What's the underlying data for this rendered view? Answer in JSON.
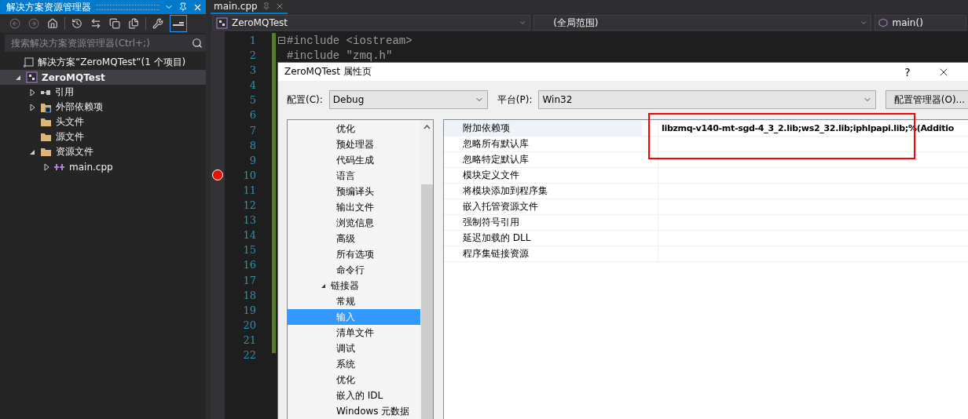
{
  "explorer": {
    "title": "解决方案资源管理器",
    "search": {
      "placeholder": "搜索解决方案资源管理器(Ctrl+;)"
    },
    "tree": [
      {
        "label": "解决方案“ZeroMQTest”(1 个项目)",
        "kind": "solution",
        "selected": false,
        "children": [
          {
            "label": "ZeroMQTest",
            "kind": "project",
            "selected": true,
            "expanded": true,
            "children": [
              {
                "label": "引用",
                "kind": "references",
                "selected": false,
                "expanded": false
              },
              {
                "label": "外部依赖项",
                "kind": "external",
                "selected": false,
                "expanded": false
              },
              {
                "label": "头文件",
                "kind": "folder",
                "selected": false
              },
              {
                "label": "源文件",
                "kind": "folder",
                "selected": false
              },
              {
                "label": "资源文件",
                "kind": "folder",
                "selected": false,
                "expanded": true,
                "children": [
                  {
                    "label": "main.cpp",
                    "kind": "cpp",
                    "selected": false,
                    "expanded": false
                  }
                ]
              }
            ]
          }
        ]
      }
    ]
  },
  "editor": {
    "tab": "main.cpp",
    "nav": {
      "project": "ZeroMQTest",
      "scope": "(全局范围)",
      "member": "main()"
    },
    "lines": [
      {
        "number": "1",
        "code": "#include <iostream>",
        "breakpoint": false,
        "fold": true
      },
      {
        "number": "2",
        "code": "#include \"zmq.h\"",
        "breakpoint": false,
        "fold": false
      },
      {
        "number": "3",
        "breakpoint": false,
        "fold": false
      },
      {
        "number": "4",
        "breakpoint": false,
        "fold": false
      },
      {
        "number": "5",
        "breakpoint": false,
        "fold": false
      },
      {
        "number": "6",
        "breakpoint": false,
        "fold": false
      },
      {
        "number": "7",
        "breakpoint": false,
        "fold": false
      },
      {
        "number": "8",
        "breakpoint": false,
        "fold": false
      },
      {
        "number": "9",
        "breakpoint": false,
        "fold": false
      },
      {
        "number": "10",
        "breakpoint": true,
        "fold": false
      },
      {
        "number": "11",
        "breakpoint": false,
        "fold": false
      },
      {
        "number": "12",
        "breakpoint": false,
        "fold": false
      },
      {
        "number": "13",
        "breakpoint": false,
        "fold": false
      },
      {
        "number": "14",
        "breakpoint": false,
        "fold": false
      },
      {
        "number": "15",
        "breakpoint": false,
        "fold": false
      },
      {
        "number": "16",
        "breakpoint": false,
        "fold": false
      },
      {
        "number": "17",
        "breakpoint": false,
        "fold": false
      },
      {
        "number": "18",
        "breakpoint": false,
        "fold": false
      },
      {
        "number": "19",
        "breakpoint": false,
        "fold": false
      },
      {
        "number": "20",
        "breakpoint": false,
        "fold": false
      },
      {
        "number": "21",
        "breakpoint": false,
        "fold": false
      },
      {
        "number": "22",
        "breakpoint": false,
        "fold": false
      }
    ]
  },
  "dialog": {
    "title": "ZeroMQTest 属性页",
    "help": "?",
    "configuration": {
      "label": "配置(C):",
      "value": "Debug"
    },
    "platform": {
      "label": "平台(P):",
      "value": "Win32"
    },
    "manager_button": "配置管理器(O)...",
    "tree": [
      {
        "label": "优化",
        "selected": false
      },
      {
        "label": "预处理器",
        "selected": false
      },
      {
        "label": "代码生成",
        "selected": false
      },
      {
        "label": "语言",
        "selected": false
      },
      {
        "label": "预编译头",
        "selected": false
      },
      {
        "label": "输出文件",
        "selected": false
      },
      {
        "label": "浏览信息",
        "selected": false
      },
      {
        "label": "高级",
        "selected": false
      },
      {
        "label": "所有选项",
        "selected": false
      },
      {
        "label": "命令行",
        "selected": false
      },
      {
        "label": "链接器",
        "selected": false,
        "expanded": true,
        "children": [
          {
            "label": "常规",
            "selected": false
          },
          {
            "label": "输入",
            "selected": true
          },
          {
            "label": "清单文件",
            "selected": false
          },
          {
            "label": "调试",
            "selected": false
          },
          {
            "label": "系统",
            "selected": false
          },
          {
            "label": "优化",
            "selected": false
          },
          {
            "label": "嵌入的 IDL",
            "selected": false
          },
          {
            "label": "Windows 元数据",
            "selected": false
          }
        ]
      }
    ],
    "properties": [
      {
        "name": "附加依赖项",
        "value": "libzmq-v140-mt-sgd-4_3_2.lib;ws2_32.lib;iphlpapi.lib;%(Additio",
        "selected": true
      },
      {
        "name": "忽略所有默认库",
        "selected": false
      },
      {
        "name": "忽略特定默认库",
        "selected": false
      },
      {
        "name": "模块定义文件",
        "selected": false
      },
      {
        "name": "将模块添加到程序集",
        "selected": false
      },
      {
        "name": "嵌入托管资源文件",
        "selected": false
      },
      {
        "name": "强制符号引用",
        "selected": false
      },
      {
        "name": "延迟加载的 DLL",
        "selected": false
      },
      {
        "name": "程序集链接资源",
        "selected": false
      }
    ],
    "annotation": {
      "kind": "rectangle",
      "color": "#ff0000"
    }
  }
}
